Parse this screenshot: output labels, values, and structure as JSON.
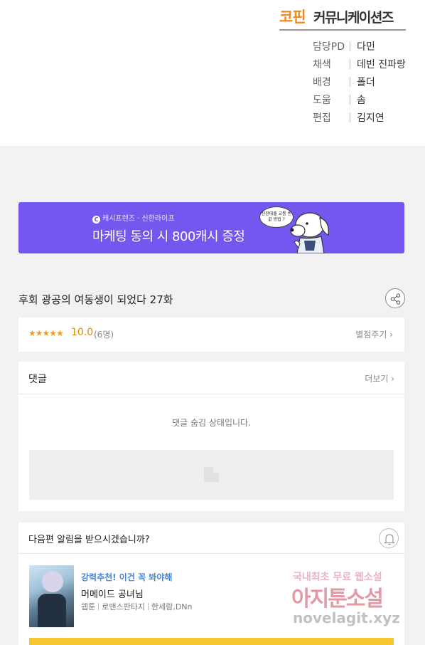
{
  "credits": {
    "logo_brand": "코핀",
    "logo_company": "커뮤니케이션즈",
    "rows": [
      {
        "role": "담당PD",
        "name": "다민"
      },
      {
        "role": "채색",
        "name": "데빈  진파랑"
      },
      {
        "role": "배경",
        "name": "폴더"
      },
      {
        "role": "도움",
        "name": "솜"
      },
      {
        "role": "편집",
        "name": "김지연"
      }
    ]
  },
  "banner": {
    "sponsor_icon": "C",
    "sponsor_text": "캐시프렌즈 · 신한라이프",
    "headline": "마케팅 동의 시 800캐시 증정",
    "bubble_text": "신한대출 교통 반값 방법 ?",
    "background_color": "#7556ee"
  },
  "episode": {
    "title": "후회 광공의 여동생이 되었다 27화",
    "share_icon": "share-icon"
  },
  "rating": {
    "stars": "★★★★★",
    "value": "10.0",
    "count": "(6명)",
    "rate_link": "별점주기 ›"
  },
  "comments": {
    "title": "댓글",
    "more_link": "더보기 ›",
    "hidden_message": "댓글 숨김 상태입니다."
  },
  "next_notice": {
    "question": "다음편 알림을 받으시겠습니까?",
    "bell_icon": "bell-icon"
  },
  "recommendation": {
    "tag": "강력추천! 이건 꼭 봐야해",
    "title": "머메이드 공녀님",
    "meta": [
      "웹툰",
      "로맨스판타지",
      "한세람,DNn"
    ]
  },
  "watermark": {
    "line1": "국내최초 무료 웹소설",
    "line2": "아지툰소설",
    "line3": "novelagit.xyz"
  }
}
